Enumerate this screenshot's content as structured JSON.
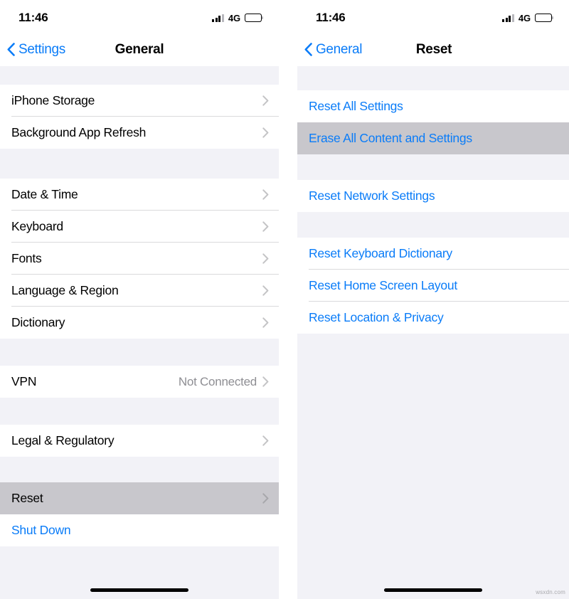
{
  "watermark": "wsxdn.com",
  "colors": {
    "accent_blue": "#0a7cf8",
    "pressed_gray": "#c8c7cc",
    "group_background": "#f2f2f7",
    "row_background": "#ffffff",
    "separator": "#d4d4d6",
    "secondary_text": "#8e8e93"
  },
  "screens": [
    {
      "id": "general",
      "status_bar": {
        "time": "11:46",
        "network": "4G",
        "signal_icon": "cellular-signal-icon",
        "battery_icon": "battery-icon"
      },
      "nav": {
        "back_label": "Settings",
        "back_icon": "chevron-left-icon",
        "title": "General"
      },
      "sections": [
        {
          "top_gap": 26,
          "rows": [
            {
              "label": "iPhone Storage",
              "style": "default",
              "accessory": "chevron-right-icon",
              "pressed": false
            },
            {
              "label": "Background App Refresh",
              "style": "default",
              "accessory": "chevron-right-icon",
              "pressed": false
            }
          ]
        },
        {
          "top_gap": 42,
          "rows": [
            {
              "label": "Date & Time",
              "style": "default",
              "accessory": "chevron-right-icon",
              "pressed": false
            },
            {
              "label": "Keyboard",
              "style": "default",
              "accessory": "chevron-right-icon",
              "pressed": false
            },
            {
              "label": "Fonts",
              "style": "default",
              "accessory": "chevron-right-icon",
              "pressed": false
            },
            {
              "label": "Language & Region",
              "style": "default",
              "accessory": "chevron-right-icon",
              "pressed": false
            },
            {
              "label": "Dictionary",
              "style": "default",
              "accessory": "chevron-right-icon",
              "pressed": false
            }
          ]
        },
        {
          "top_gap": 38,
          "rows": [
            {
              "label": "VPN",
              "value": "Not Connected",
              "style": "default",
              "accessory": "chevron-right-icon",
              "pressed": false
            }
          ]
        },
        {
          "top_gap": 38,
          "rows": [
            {
              "label": "Legal & Regulatory",
              "style": "default",
              "accessory": "chevron-right-icon",
              "pressed": false
            }
          ]
        },
        {
          "top_gap": 36,
          "rows": [
            {
              "label": "Reset",
              "style": "default",
              "accessory": "chevron-right-icon",
              "pressed": true
            },
            {
              "label": "Shut Down",
              "style": "blue",
              "accessory": "none",
              "pressed": false
            }
          ]
        }
      ]
    },
    {
      "id": "reset",
      "status_bar": {
        "time": "11:46",
        "network": "4G",
        "signal_icon": "cellular-signal-icon",
        "battery_icon": "battery-icon"
      },
      "nav": {
        "back_label": "General",
        "back_icon": "chevron-left-icon",
        "title": "Reset"
      },
      "sections": [
        {
          "top_gap": 34,
          "rows": [
            {
              "label": "Reset All Settings",
              "style": "blue",
              "accessory": "none",
              "pressed": false
            },
            {
              "label": "Erase All Content and Settings",
              "style": "blue",
              "accessory": "none",
              "pressed": true
            }
          ]
        },
        {
          "top_gap": 36,
          "rows": [
            {
              "label": "Reset Network Settings",
              "style": "blue",
              "accessory": "none",
              "pressed": false
            }
          ]
        },
        {
          "top_gap": 36,
          "rows": [
            {
              "label": "Reset Keyboard Dictionary",
              "style": "blue",
              "accessory": "none",
              "pressed": false
            },
            {
              "label": "Reset Home Screen Layout",
              "style": "blue",
              "accessory": "none",
              "pressed": false
            },
            {
              "label": "Reset Location & Privacy",
              "style": "blue",
              "accessory": "none",
              "pressed": false
            }
          ]
        }
      ]
    }
  ]
}
